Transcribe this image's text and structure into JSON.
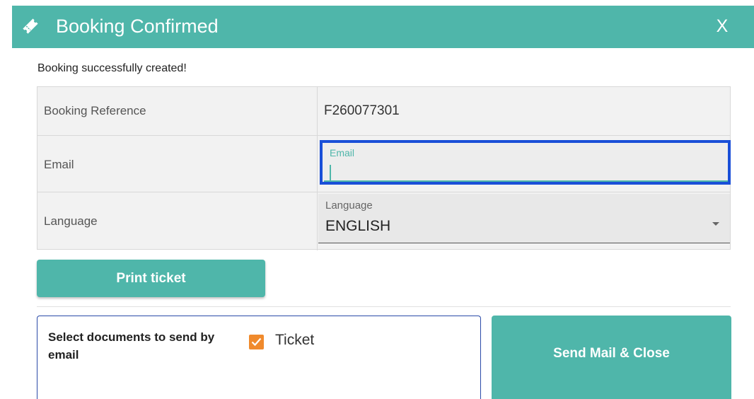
{
  "dialog": {
    "title": "Booking Confirmed",
    "close_label": "X",
    "title_icon": "ticket-icon",
    "accent_color": "#4fb6aa"
  },
  "message": "Booking successfully created!",
  "fields": {
    "reference": {
      "label": "Booking Reference",
      "value": "F260077301"
    },
    "email": {
      "label": "Email",
      "field_label": "Email",
      "value": ""
    },
    "language": {
      "label": "Language",
      "field_label": "Language",
      "value": "ENGLISH"
    }
  },
  "actions": {
    "print_label": "Print ticket",
    "send_label": "Send Mail & Close"
  },
  "documents": {
    "label": "Select documents to send by email",
    "ticket_label": "Ticket",
    "ticket_checked": true,
    "check_color": "#f08a2c"
  },
  "focus_outline_color": "#1a4fd8"
}
